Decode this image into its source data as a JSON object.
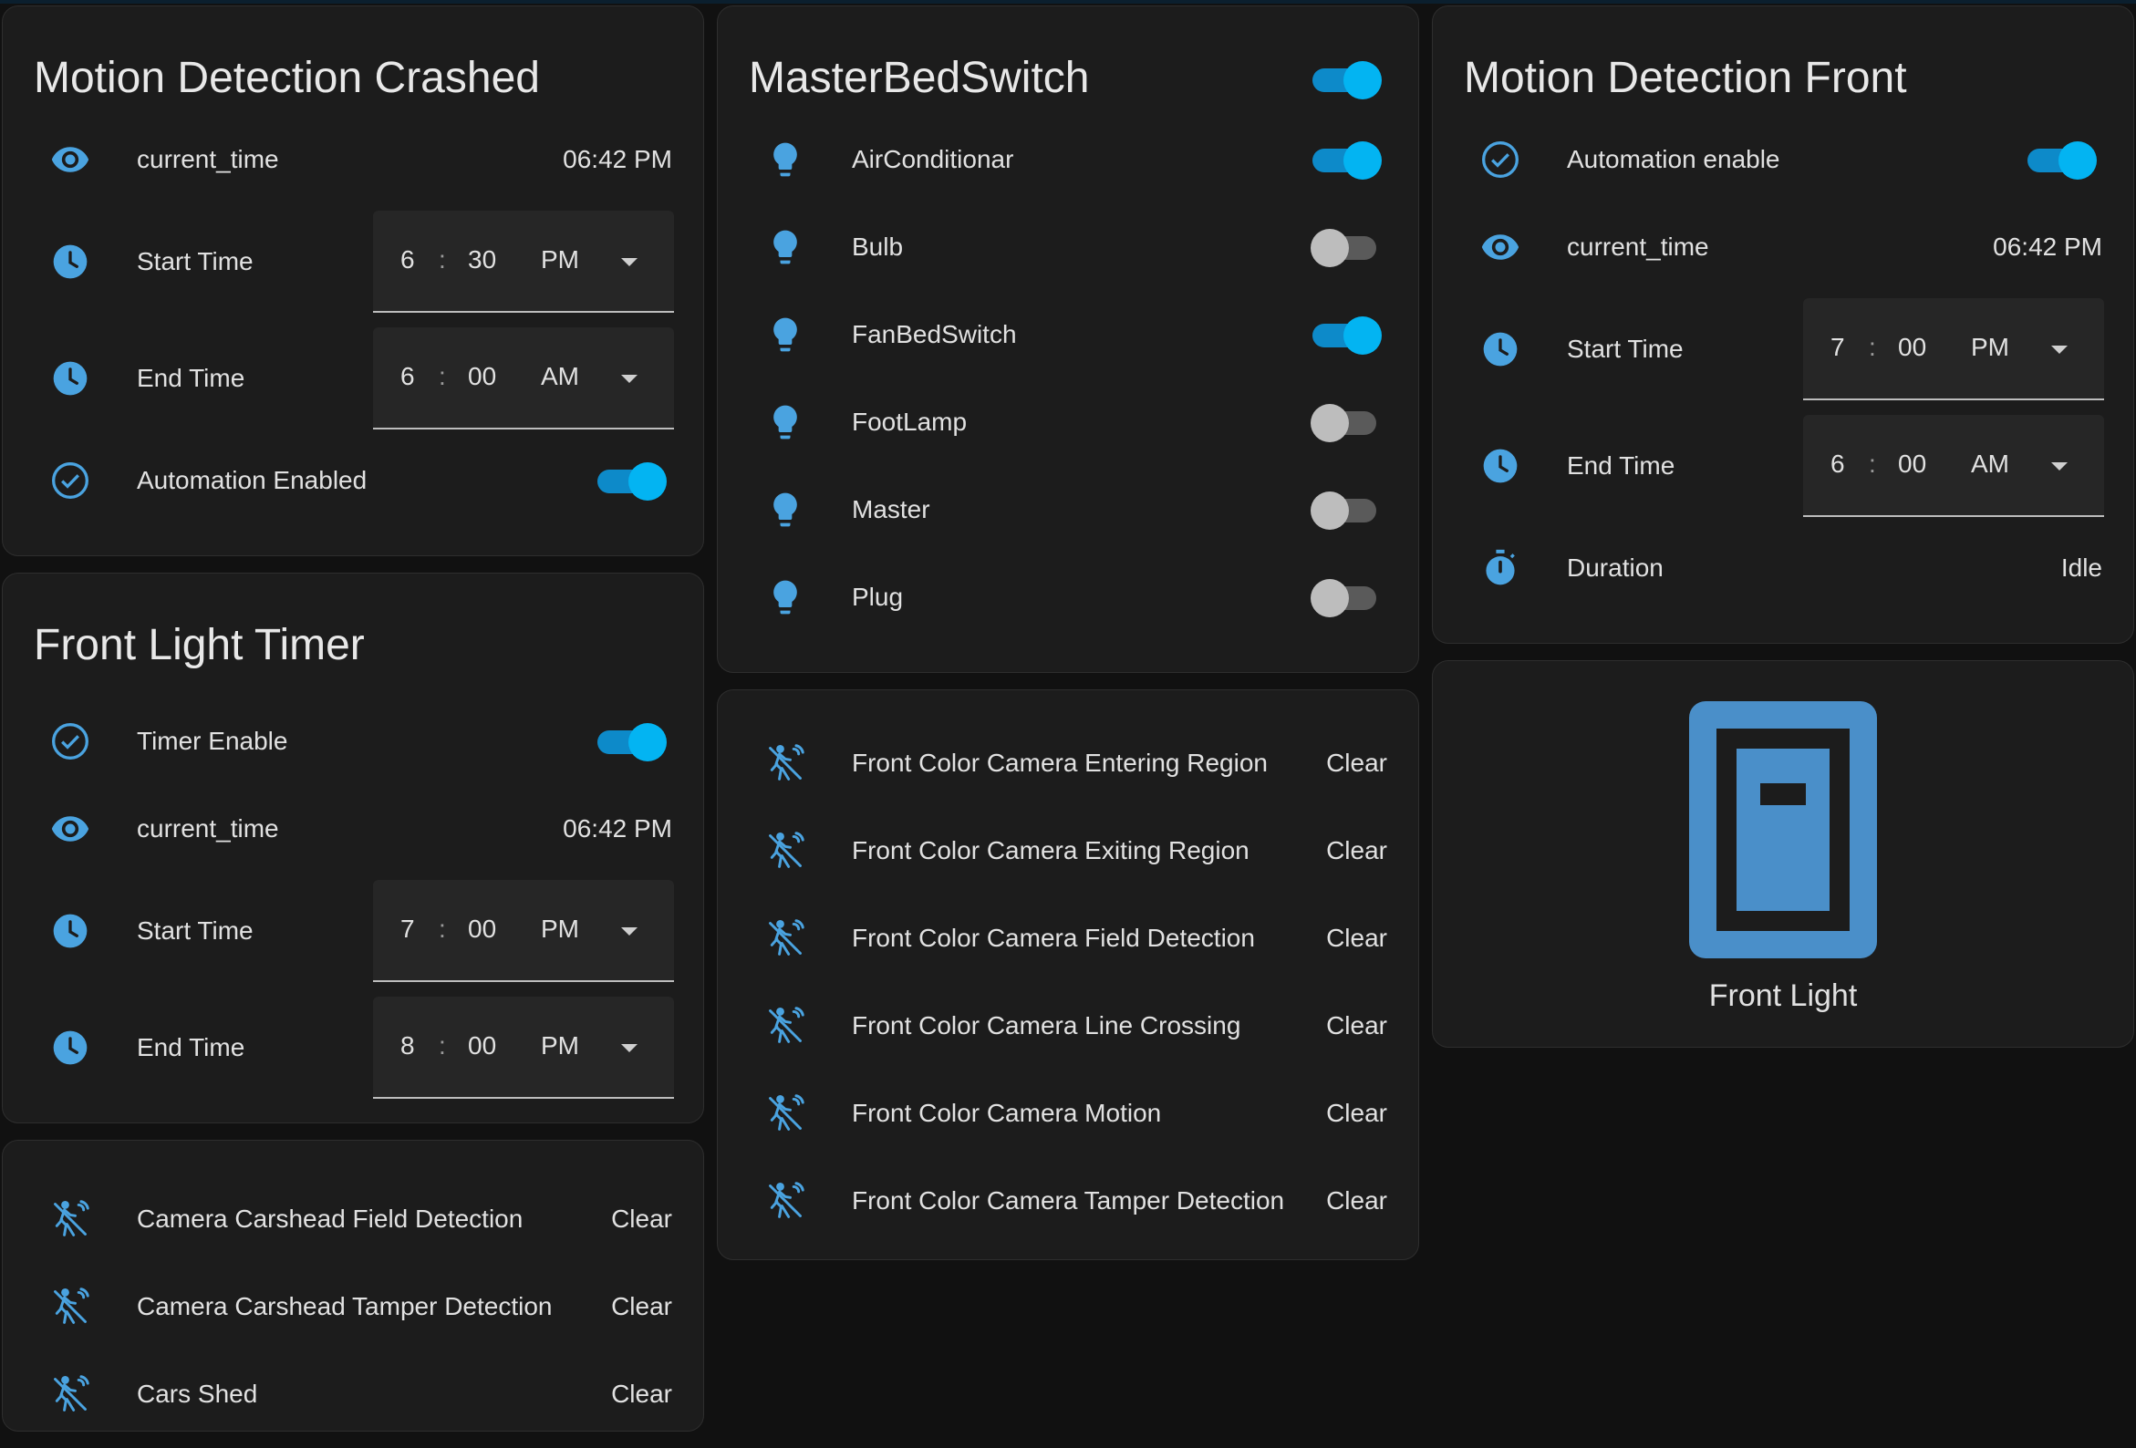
{
  "colors": {
    "accent": "#03b4f2",
    "icon": "#4aa3e0",
    "card_bg": "#1c1c1c",
    "page_bg": "#111111"
  },
  "motion_crashed": {
    "title": "Motion Detection Crashed",
    "rows": [
      {
        "icon": "eye-icon",
        "label": "current_time",
        "value": "06:42 PM"
      },
      {
        "icon": "clock-icon",
        "label": "Start Time",
        "hour": "6",
        "sep": ":",
        "minute": "30",
        "ampm": "PM"
      },
      {
        "icon": "clock-icon",
        "label": "End Time",
        "hour": "6",
        "sep": ":",
        "minute": "00",
        "ampm": "AM"
      },
      {
        "icon": "check-circle-icon",
        "label": "Automation Enabled",
        "state": "on"
      }
    ]
  },
  "front_light_timer": {
    "title": "Front Light Timer",
    "rows": [
      {
        "icon": "check-circle-icon",
        "label": "Timer Enable",
        "state": "on"
      },
      {
        "icon": "eye-icon",
        "label": "current_time",
        "value": "06:42 PM"
      },
      {
        "icon": "clock-icon",
        "label": "Start Time",
        "hour": "7",
        "sep": ":",
        "minute": "00",
        "ampm": "PM"
      },
      {
        "icon": "clock-icon",
        "label": "End Time",
        "hour": "8",
        "sep": ":",
        "minute": "00",
        "ampm": "PM"
      }
    ]
  },
  "carshed_events": {
    "rows": [
      {
        "icon": "motion-sensor-icon",
        "label": "Camera Carshead Field Detection",
        "value": "Clear"
      },
      {
        "icon": "motion-sensor-icon",
        "label": "Camera Carshead Tamper Detection",
        "value": "Clear"
      },
      {
        "icon": "motion-sensor-icon",
        "label": "Cars Shed",
        "value": "Clear"
      }
    ]
  },
  "master_bed": {
    "title": "MasterBedSwitch",
    "state": "on",
    "rows": [
      {
        "icon": "bulb-icon",
        "label": "AirConditionar",
        "state": "on"
      },
      {
        "icon": "bulb-icon",
        "label": "Bulb",
        "state": "off"
      },
      {
        "icon": "bulb-icon",
        "label": "FanBedSwitch",
        "state": "on"
      },
      {
        "icon": "bulb-icon",
        "label": "FootLamp",
        "state": "off"
      },
      {
        "icon": "bulb-icon",
        "label": "Master",
        "state": "off"
      },
      {
        "icon": "bulb-icon",
        "label": "Plug",
        "state": "off"
      }
    ]
  },
  "front_camera_events": {
    "rows": [
      {
        "icon": "motion-sensor-icon",
        "label": "Front Color Camera Entering Region",
        "value": "Clear"
      },
      {
        "icon": "motion-sensor-icon",
        "label": "Front Color Camera Exiting Region",
        "value": "Clear"
      },
      {
        "icon": "motion-sensor-icon",
        "label": "Front Color Camera Field Detection",
        "value": "Clear"
      },
      {
        "icon": "motion-sensor-icon",
        "label": "Front Color Camera Line Crossing",
        "value": "Clear"
      },
      {
        "icon": "motion-sensor-icon",
        "label": "Front Color Camera Motion",
        "value": "Clear"
      },
      {
        "icon": "motion-sensor-icon",
        "label": "Front Color Camera Tamper Detection",
        "value": "Clear"
      }
    ]
  },
  "motion_front": {
    "title": "Motion Detection Front",
    "rows": [
      {
        "icon": "check-circle-icon",
        "label": "Automation enable",
        "state": "on"
      },
      {
        "icon": "eye-icon",
        "label": "current_time",
        "value": "06:42 PM"
      },
      {
        "icon": "clock-icon",
        "label": "Start Time",
        "hour": "7",
        "sep": ":",
        "minute": "00",
        "ampm": "PM"
      },
      {
        "icon": "clock-icon",
        "label": "End Time",
        "hour": "6",
        "sep": ":",
        "minute": "00",
        "ampm": "AM"
      },
      {
        "icon": "timer-icon",
        "label": "Duration",
        "value": "Idle"
      }
    ]
  },
  "front_light": {
    "name": "Front Light",
    "icon": "door-icon"
  }
}
